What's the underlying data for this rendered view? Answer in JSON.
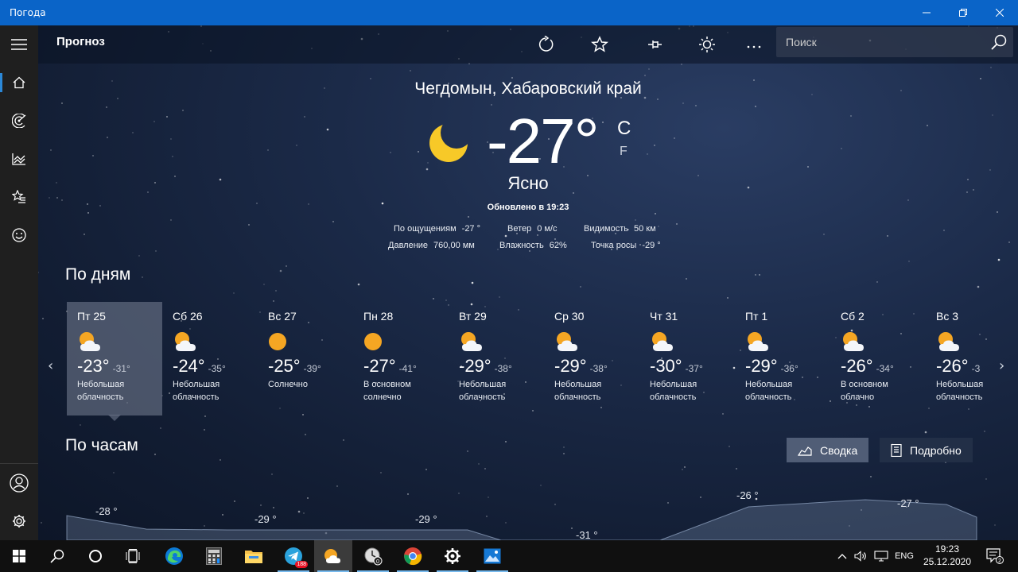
{
  "window": {
    "title": "Погода"
  },
  "commandbar": {
    "page_title": "Прогноз",
    "search_placeholder": "Поиск"
  },
  "current": {
    "location": "Чегдомын, Хабаровский край",
    "temperature": "-27°",
    "unit_c": "C",
    "unit_f": "F",
    "condition": "Ясно",
    "updated": "Обновлено в 19:23",
    "feels_like_label": "По ощущениям",
    "feels_like": "-27 °",
    "wind_label": "Ветер",
    "wind": "0 м/с",
    "visibility_label": "Видимость",
    "visibility": "50 км",
    "pressure_label": "Давление",
    "pressure": "760,00 мм",
    "humidity_label": "Влажность",
    "humidity": "62%",
    "dew_label": "Точка росы",
    "dew": "-29 °"
  },
  "daily": {
    "title": "По дням",
    "days": [
      {
        "name": "Пт 25",
        "hi": "-23°",
        "lo": "-31°",
        "cond1": "Небольшая",
        "cond2": "облачность",
        "icon": "partly-cloudy"
      },
      {
        "name": "Сб 26",
        "hi": "-24°",
        "lo": "-35°",
        "cond1": "Небольшая",
        "cond2": "облачность",
        "icon": "partly-cloudy"
      },
      {
        "name": "Вс 27",
        "hi": "-25°",
        "lo": "-39°",
        "cond1": "Солнечно",
        "cond2": "",
        "icon": "sunny"
      },
      {
        "name": "Пн 28",
        "hi": "-27°",
        "lo": "-41°",
        "cond1": "В основном",
        "cond2": "солнечно",
        "icon": "sunny"
      },
      {
        "name": "Вт 29",
        "hi": "-29°",
        "lo": "-38°",
        "cond1": "Небольшая",
        "cond2": "облачность",
        "icon": "partly-cloudy"
      },
      {
        "name": "Ср 30",
        "hi": "-29°",
        "lo": "-38°",
        "cond1": "Небольшая",
        "cond2": "облачность",
        "icon": "partly-cloudy"
      },
      {
        "name": "Чт 31",
        "hi": "-30°",
        "lo": "-37°",
        "cond1": "Небольшая",
        "cond2": "облачность",
        "icon": "partly-cloudy"
      },
      {
        "name": "Пт 1",
        "hi": "-29°",
        "lo": "-36°",
        "cond1": "Небольшая",
        "cond2": "облачность",
        "icon": "partly-cloudy"
      },
      {
        "name": "Сб 2",
        "hi": "-26°",
        "lo": "-34°",
        "cond1": "В основном",
        "cond2": "облачно",
        "icon": "partly-cloudy"
      },
      {
        "name": "Вс 3",
        "hi": "-26°",
        "lo": "-3",
        "cond1": "Небольшая",
        "cond2": "облачность",
        "icon": "partly-cloudy"
      }
    ]
  },
  "hourly": {
    "title": "По часам",
    "summary_label": "Сводка",
    "detailed_label": "Подробно",
    "labels": [
      "-28 °",
      "-29 °",
      "-29 °",
      "-31 °",
      "-26 °",
      "-27 °"
    ]
  },
  "taskbar": {
    "language": "ENG",
    "time": "19:23",
    "date": "25.12.2020",
    "telegram_badge": "188",
    "notifications": "2"
  },
  "colors": {
    "accent": "#0a64c8",
    "sun": "#f5a623",
    "moon": "#f7c928"
  }
}
